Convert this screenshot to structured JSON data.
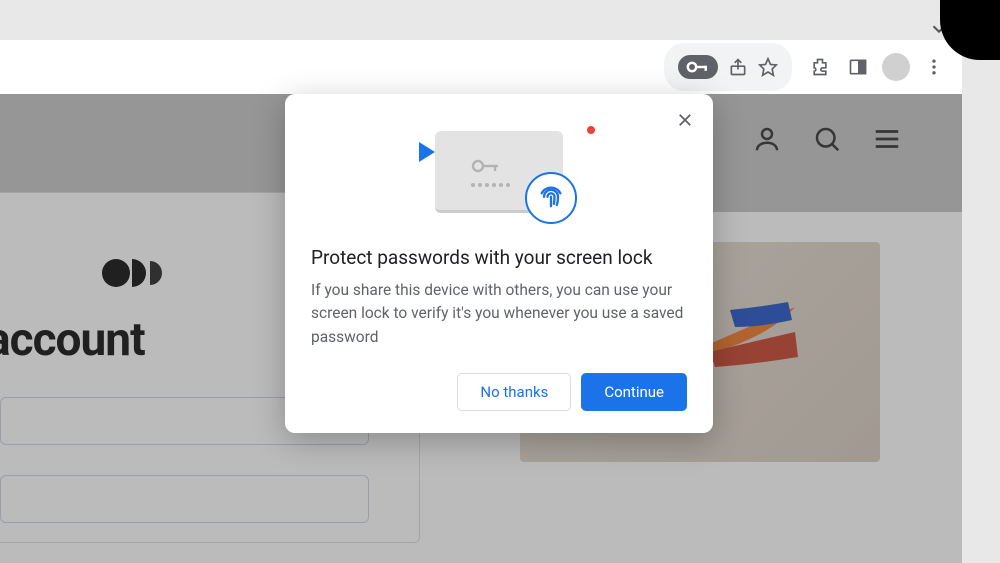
{
  "toolbar": {
    "icons": {
      "key": "password-key-icon",
      "share": "share-icon",
      "star": "star-icon",
      "extensions": "extensions-icon",
      "sidepanel": "sidepanel-icon",
      "profile": "profile-avatar",
      "menu": "kebab-menu-icon"
    }
  },
  "site_header": {
    "icons": {
      "account": "account-icon",
      "search": "search-icon",
      "menu": "hamburger-icon"
    }
  },
  "login": {
    "title_fragment": "our account"
  },
  "dialog": {
    "title": "Protect passwords with your screen lock",
    "body": "If you share this device with others, you can use your screen lock to verify it's you whenever you use a saved password",
    "secondary_label": "No thanks",
    "primary_label": "Continue"
  }
}
